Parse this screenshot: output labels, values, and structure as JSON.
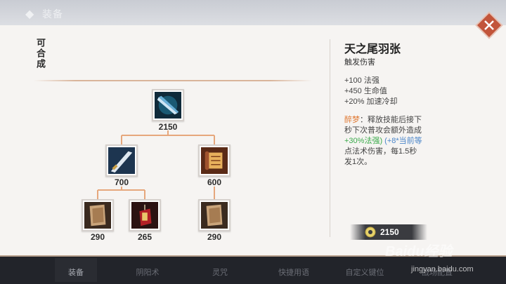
{
  "header": {
    "title": "装备",
    "icon": "diamond-icon"
  },
  "close_button": {
    "icon": "close-icon"
  },
  "left_section": {
    "label": "可合成"
  },
  "tree": {
    "root": {
      "price": "2150",
      "icon": "sword-blue-icon"
    },
    "level2": [
      {
        "price": "700",
        "icon": "blade-icon"
      },
      {
        "price": "600",
        "icon": "scroll-icon"
      }
    ],
    "level3": [
      {
        "price": "290",
        "icon": "paper-book-icon"
      },
      {
        "price": "265",
        "icon": "red-amulet-icon"
      },
      {
        "price": "290",
        "icon": "paper-book-icon"
      }
    ]
  },
  "detail": {
    "title": "天之尾羽张",
    "subtitle": "触发伤害",
    "stats": [
      "+100 法强",
      "+450 生命值",
      "+20% 加速冷却"
    ],
    "passive": {
      "name": "醉梦",
      "line1_rest": "：释放技能后接下",
      "line2": "秒下次普攻会额外造成",
      "line3_green": "+30%法强)",
      "line3_blue": "(+8*当前等",
      "line4": " 点法术伤害，每1.5秒",
      "line5": "发1次。"
    },
    "price": "2150",
    "price_icon": "coin-icon"
  },
  "bottom_nav": {
    "tabs": [
      "装备",
      "阴阳术",
      "灵咒",
      "快捷用语",
      "自定义键位",
      "战场配置"
    ],
    "active_index": 0
  },
  "watermark": {
    "logo": "Baidu经验",
    "url": "jingyan.baidu.com"
  },
  "colors": {
    "accent_close": "#c2553b",
    "passive_name": "#e07a35",
    "green": "#3aaa4a",
    "blue": "#4b86c9",
    "line": "#e6a77c"
  }
}
